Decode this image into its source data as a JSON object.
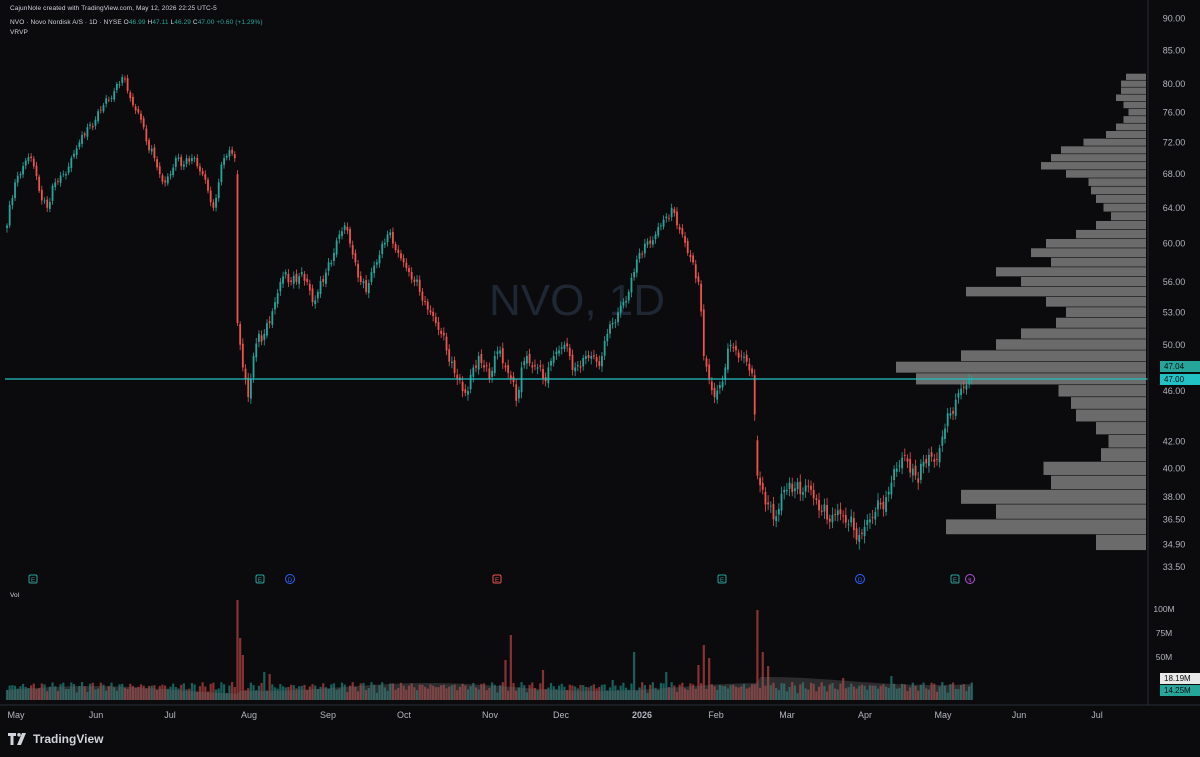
{
  "header": {
    "created_by": "CajunNole created with TradingView.com, May 12, 2026 22:25 UTC-5",
    "symbol_line": "NVO · Novo Nordisk A/S · 1D · NYSE",
    "ohlc": {
      "o_label": "O",
      "o": "46.99",
      "h_label": "H",
      "h": "47.11",
      "l_label": "L",
      "l": "46.29",
      "c_label": "C",
      "c": "47.00",
      "change": "+0.60 (+1.29%)"
    },
    "indicator": "VRVP"
  },
  "watermark": "NVO, 1D",
  "volume_label": "Vol",
  "footer": {
    "brand": "TradingView"
  },
  "colors": {
    "up": "#26a69a",
    "down": "#ef5350",
    "price_line": "#22c1c3",
    "profile": "#6b6b6b",
    "background": "#0b0b0e"
  },
  "chart_data": {
    "type": "candlestick",
    "symbol": "NVO",
    "interval": "1D",
    "last_price": 47.0,
    "price_badges": [
      "47.04",
      "47.00"
    ],
    "volume_badges": [
      "18.19M",
      "14.25M"
    ],
    "y_ticks": [
      "90.00",
      "85.00",
      "80.00",
      "76.00",
      "72.00",
      "68.00",
      "64.00",
      "60.00",
      "56.00",
      "53.00",
      "50.00",
      "46.00",
      "42.00",
      "40.00",
      "38.00",
      "36.50",
      "34.90",
      "33.50"
    ],
    "volume_ticks": [
      "100M",
      "75M",
      "50M"
    ],
    "x_ticks": [
      "May",
      "Jun",
      "Jul",
      "Aug",
      "Sep",
      "Oct",
      "Nov",
      "Dec",
      "2026",
      "Feb",
      "Mar",
      "Apr",
      "May",
      "Jun",
      "Jul"
    ],
    "anchors": [
      [
        0,
        62
      ],
      [
        3,
        67
      ],
      [
        6,
        69
      ],
      [
        9,
        70
      ],
      [
        12,
        66
      ],
      [
        15,
        64
      ],
      [
        18,
        67
      ],
      [
        21,
        68
      ],
      [
        24,
        70
      ],
      [
        27,
        72
      ],
      [
        30,
        74
      ],
      [
        33,
        75
      ],
      [
        36,
        77
      ],
      [
        39,
        78
      ],
      [
        41,
        80
      ],
      [
        43,
        81
      ],
      [
        45,
        79
      ],
      [
        47,
        77
      ],
      [
        49,
        76
      ],
      [
        51,
        74
      ],
      [
        53,
        71
      ],
      [
        55,
        70
      ],
      [
        57,
        68
      ],
      [
        59,
        67
      ],
      [
        61,
        68
      ],
      [
        63,
        70
      ],
      [
        65,
        69
      ],
      [
        67,
        70
      ],
      [
        69,
        70
      ],
      [
        71,
        69
      ],
      [
        73,
        68
      ],
      [
        75,
        66
      ],
      [
        77,
        64
      ],
      [
        79,
        67
      ],
      [
        81,
        70
      ],
      [
        83,
        71
      ],
      [
        85,
        70
      ],
      [
        86,
        52
      ],
      [
        87,
        50
      ],
      [
        88,
        48
      ],
      [
        89,
        47
      ],
      [
        90,
        45.5
      ],
      [
        91,
        47
      ],
      [
        92,
        49
      ],
      [
        94,
        51
      ],
      [
        96,
        51
      ],
      [
        98,
        52
      ],
      [
        100,
        54
      ],
      [
        102,
        56
      ],
      [
        104,
        57
      ],
      [
        106,
        56
      ],
      [
        108,
        56
      ],
      [
        110,
        57
      ],
      [
        112,
        56
      ],
      [
        114,
        54
      ],
      [
        116,
        55
      ],
      [
        118,
        56
      ],
      [
        120,
        58
      ],
      [
        122,
        59
      ],
      [
        124,
        61
      ],
      [
        126,
        62
      ],
      [
        128,
        60
      ],
      [
        130,
        58
      ],
      [
        132,
        56
      ],
      [
        134,
        55
      ],
      [
        136,
        57
      ],
      [
        138,
        58
      ],
      [
        140,
        60
      ],
      [
        142,
        61
      ],
      [
        144,
        60
      ],
      [
        146,
        59
      ],
      [
        148,
        58
      ],
      [
        150,
        57
      ],
      [
        152,
        56
      ],
      [
        154,
        55
      ],
      [
        156,
        54
      ],
      [
        158,
        53
      ],
      [
        160,
        52
      ],
      [
        162,
        51
      ],
      [
        164,
        49.5
      ],
      [
        166,
        48.5
      ],
      [
        168,
        47
      ],
      [
        170,
        46
      ],
      [
        172,
        46
      ],
      [
        174,
        48
      ],
      [
        176,
        49
      ],
      [
        178,
        48
      ],
      [
        180,
        47
      ],
      [
        182,
        49
      ],
      [
        184,
        49.5
      ],
      [
        186,
        48
      ],
      [
        188,
        47
      ],
      [
        190,
        45.2
      ],
      [
        192,
        48
      ],
      [
        194,
        49
      ],
      [
        196,
        48
      ],
      [
        198,
        48
      ],
      [
        200,
        47
      ],
      [
        202,
        48
      ],
      [
        204,
        49
      ],
      [
        206,
        49.5
      ],
      [
        208,
        50
      ],
      [
        210,
        49
      ],
      [
        212,
        48
      ],
      [
        214,
        48
      ],
      [
        216,
        49
      ],
      [
        218,
        49
      ],
      [
        220,
        48.5
      ],
      [
        222,
        49
      ],
      [
        224,
        51
      ],
      [
        226,
        52
      ],
      [
        228,
        53
      ],
      [
        230,
        54
      ],
      [
        232,
        55
      ],
      [
        234,
        57
      ],
      [
        236,
        59
      ],
      [
        238,
        60
      ],
      [
        240,
        60
      ],
      [
        242,
        61
      ],
      [
        244,
        62
      ],
      [
        246,
        63
      ],
      [
        248,
        64
      ],
      [
        250,
        62
      ],
      [
        252,
        61
      ],
      [
        254,
        59
      ],
      [
        256,
        58
      ],
      [
        258,
        56
      ],
      [
        260,
        49
      ],
      [
        262,
        47
      ],
      [
        264,
        45.5
      ],
      [
        266,
        46.5
      ],
      [
        268,
        48
      ],
      [
        270,
        50
      ],
      [
        272,
        49.5
      ],
      [
        274,
        49
      ],
      [
        276,
        48.5
      ],
      [
        278,
        47.5
      ],
      [
        280,
        39.5
      ],
      [
        282,
        38.5
      ],
      [
        284,
        37.5
      ],
      [
        286,
        36.5
      ],
      [
        288,
        37.2
      ],
      [
        290,
        38.5
      ],
      [
        292,
        39
      ],
      [
        294,
        38.6
      ],
      [
        296,
        38.2
      ],
      [
        298,
        38.8
      ],
      [
        300,
        38.5
      ],
      [
        302,
        37.8
      ],
      [
        304,
        37
      ],
      [
        306,
        36.5
      ],
      [
        308,
        36.8
      ],
      [
        310,
        37.1
      ],
      [
        312,
        36.7
      ],
      [
        314,
        36.2
      ],
      [
        316,
        35.8
      ],
      [
        318,
        35.5
      ],
      [
        320,
        36
      ],
      [
        322,
        36.5
      ],
      [
        324,
        37
      ],
      [
        326,
        37.5
      ],
      [
        328,
        38
      ],
      [
        330,
        39
      ],
      [
        332,
        40
      ],
      [
        334,
        40.8
      ],
      [
        336,
        40.5
      ],
      [
        338,
        40
      ],
      [
        340,
        39
      ],
      [
        342,
        40.5
      ],
      [
        344,
        41
      ],
      [
        346,
        40.5
      ],
      [
        348,
        41.5
      ],
      [
        350,
        43
      ],
      [
        352,
        44.2
      ],
      [
        354,
        45.3
      ],
      [
        356,
        46.2
      ],
      [
        358,
        46.5
      ],
      [
        360,
        47.0
      ]
    ],
    "profile_bins": [
      [
        81,
        0.08
      ],
      [
        80,
        0.1
      ],
      [
        79,
        0.1
      ],
      [
        78,
        0.12
      ],
      [
        77,
        0.09
      ],
      [
        76,
        0.07
      ],
      [
        75,
        0.09
      ],
      [
        74,
        0.12
      ],
      [
        73,
        0.16
      ],
      [
        72,
        0.25
      ],
      [
        71,
        0.34
      ],
      [
        70,
        0.38
      ],
      [
        69,
        0.42
      ],
      [
        68,
        0.32
      ],
      [
        67,
        0.23
      ],
      [
        66,
        0.22
      ],
      [
        65,
        0.2
      ],
      [
        64,
        0.17
      ],
      [
        63,
        0.14
      ],
      [
        62,
        0.2
      ],
      [
        61,
        0.28
      ],
      [
        60,
        0.4
      ],
      [
        59,
        0.46
      ],
      [
        58,
        0.38
      ],
      [
        57,
        0.6
      ],
      [
        56,
        0.5
      ],
      [
        55,
        0.72
      ],
      [
        54,
        0.4
      ],
      [
        53,
        0.32
      ],
      [
        52,
        0.36
      ],
      [
        51,
        0.5
      ],
      [
        50,
        0.6
      ],
      [
        49,
        0.74
      ],
      [
        48,
        1.0
      ],
      [
        47,
        0.92
      ],
      [
        46,
        0.35
      ],
      [
        45,
        0.3
      ],
      [
        44,
        0.28
      ],
      [
        43,
        0.2
      ],
      [
        42,
        0.15
      ],
      [
        41,
        0.18
      ],
      [
        40,
        0.41
      ],
      [
        39,
        0.38
      ],
      [
        38,
        0.74
      ],
      [
        37,
        0.6
      ],
      [
        36,
        0.8
      ],
      [
        35,
        0.2
      ]
    ]
  }
}
